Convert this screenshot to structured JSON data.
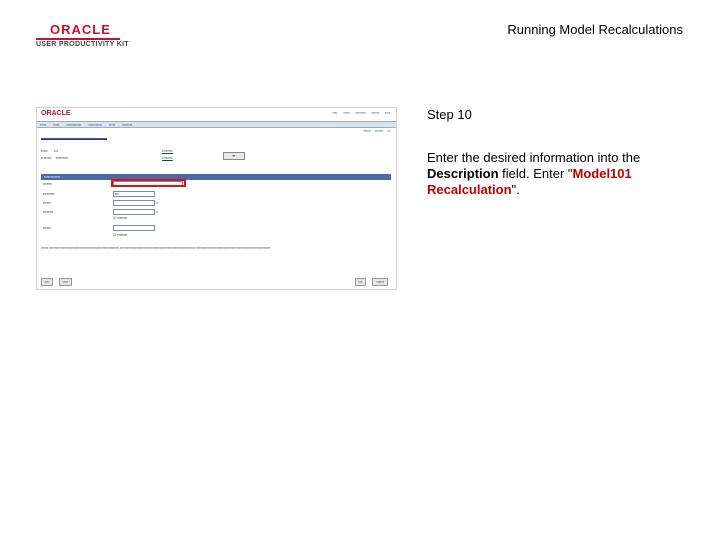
{
  "brand": {
    "name": "ORACLE",
    "product": "USER PRODUCTIVITY KIT"
  },
  "page_title": "Running Model Recalculations",
  "step": {
    "label": "Step 10",
    "instruction_pre": "Enter the desired information into the ",
    "field_name": "Description",
    "instruction_mid": " field. Enter \"",
    "value": "Model101 Recalculation",
    "instruction_post": "\"."
  },
  "colors": {
    "highlight": "#e01010",
    "value_text": "#c00000",
    "oracle_red": "#c8102e"
  }
}
